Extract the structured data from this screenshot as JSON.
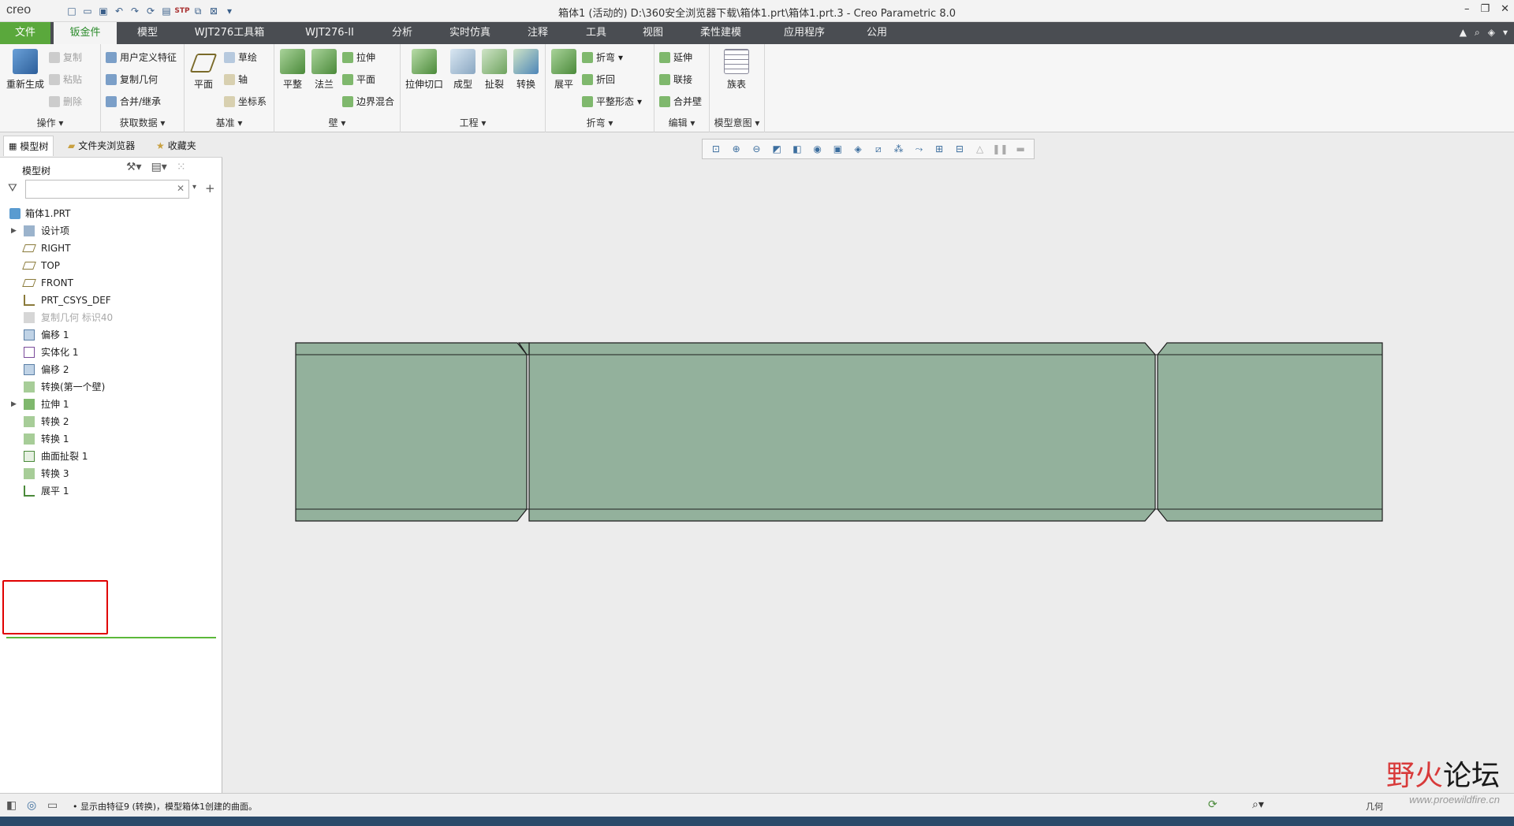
{
  "app": {
    "logo": "creo",
    "window_title": "箱体1 (活动的) D:\\360安全浏览器下载\\箱体1.prt\\箱体1.prt.3 - Creo Parametric 8.0"
  },
  "menu": {
    "tabs": [
      "文件",
      "钣金件",
      "模型",
      "WJT276工具箱",
      "WJT276-II",
      "分析",
      "实时仿真",
      "注释",
      "工具",
      "视图",
      "柔性建模",
      "应用程序",
      "公用"
    ],
    "active": "钣金件"
  },
  "ribbon": {
    "groups": [
      {
        "label": "操作",
        "big": [
          "重新生成"
        ],
        "small": [
          "复制",
          "粘贴",
          "删除"
        ]
      },
      {
        "label": "获取数据",
        "small": [
          "用户定义特征",
          "复制几何",
          "合并/继承"
        ]
      },
      {
        "label": "基准",
        "big": [
          "平面"
        ],
        "small": [
          "草绘",
          "轴",
          "坐标系"
        ]
      },
      {
        "label": "壁",
        "big": [
          "平整",
          "法兰"
        ],
        "small": [
          "拉伸",
          "平面",
          "边界混合"
        ]
      },
      {
        "label": "工程",
        "big": [
          "拉伸切口",
          "成型",
          "扯裂",
          "转换"
        ]
      },
      {
        "label": "折弯",
        "big": [
          "展平"
        ],
        "small": [
          "折弯",
          "折回",
          "平整形态"
        ]
      },
      {
        "label": "编辑",
        "small": [
          "延伸",
          "联接",
          "合并壁"
        ]
      },
      {
        "label": "模型意图",
        "big": [
          "族表"
        ]
      }
    ]
  },
  "left_panel": {
    "tabs": [
      "模型树",
      "文件夹浏览器",
      "收藏夹"
    ],
    "tree_header": "模型树",
    "filter_placeholder": "",
    "tree": [
      {
        "label": "箱体1.PRT",
        "expand": ""
      },
      {
        "label": "设计项",
        "expand": "▶"
      },
      {
        "label": "RIGHT",
        "expand": ""
      },
      {
        "label": "TOP",
        "expand": ""
      },
      {
        "label": "FRONT",
        "expand": ""
      },
      {
        "label": "PRT_CSYS_DEF",
        "expand": ""
      },
      {
        "label": "复制几何 标识40",
        "expand": ""
      },
      {
        "label": "偏移 1",
        "expand": ""
      },
      {
        "label": "实体化 1",
        "expand": ""
      },
      {
        "label": "偏移 2",
        "expand": ""
      },
      {
        "label": "转换(第一个壁)",
        "expand": ""
      },
      {
        "label": "拉伸 1",
        "expand": "▶"
      },
      {
        "label": "转换 2",
        "expand": ""
      },
      {
        "label": "转换 1",
        "expand": ""
      },
      {
        "label": "曲面扯裂 1",
        "expand": ""
      },
      {
        "label": "转换 3",
        "expand": ""
      },
      {
        "label": "展平 1",
        "expand": ""
      }
    ]
  },
  "status": {
    "message": "• 显示由特征9 (转换)，模型箱体1创建的曲面。",
    "right_field": "几何"
  },
  "watermark": {
    "title_a": "野",
    "title_b": "火",
    "title_c": "论坛",
    "url": "www.proewildfire.cn"
  },
  "colors": {
    "accent": "#5aa83c",
    "model_fill": "#93b19c",
    "highlight": "#e00000"
  }
}
